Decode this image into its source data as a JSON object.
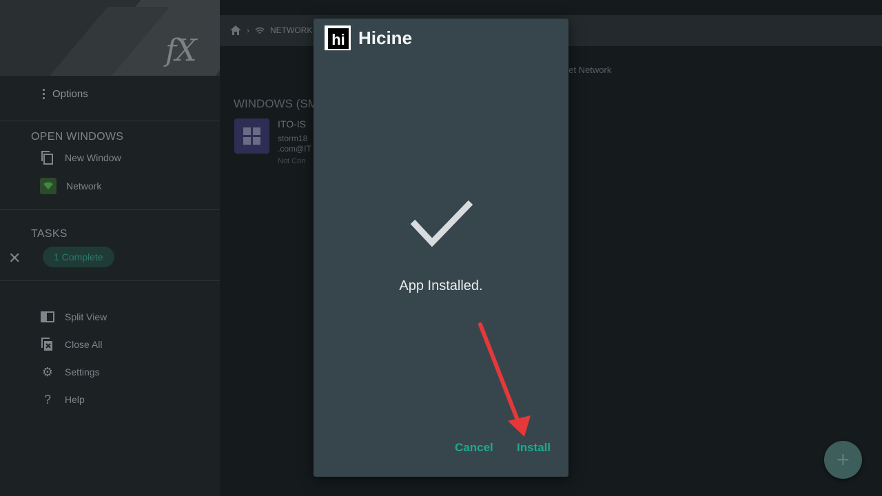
{
  "sidebar": {
    "options_label": "Options",
    "open_windows_title": "OPEN WINDOWS",
    "open_windows": [
      {
        "label": "New Window"
      },
      {
        "label": "Network"
      }
    ],
    "tasks_title": "TASKS",
    "task_pill": "1 Complete",
    "bottom_items": [
      {
        "label": "Split View"
      },
      {
        "label": "Close All"
      },
      {
        "label": "Settings"
      },
      {
        "label": "Help"
      }
    ]
  },
  "header": {
    "crumb": "NETWORK"
  },
  "content": {
    "network_label": "net Network",
    "windows_title": "WINDOWS (SM",
    "item_name": "ITO-IS",
    "item_line1": "storm18",
    "item_line2": ".com@IT",
    "item_line3": "Not Con"
  },
  "dialog": {
    "app_logo_text": "hi",
    "app_name": "Hicine",
    "status": "App Installed.",
    "cancel_label": "Cancel",
    "install_label": "Install"
  },
  "colors": {
    "accent": "#1fa88f",
    "dialog_bg": "#37464c",
    "arrow": "#e5383b"
  }
}
